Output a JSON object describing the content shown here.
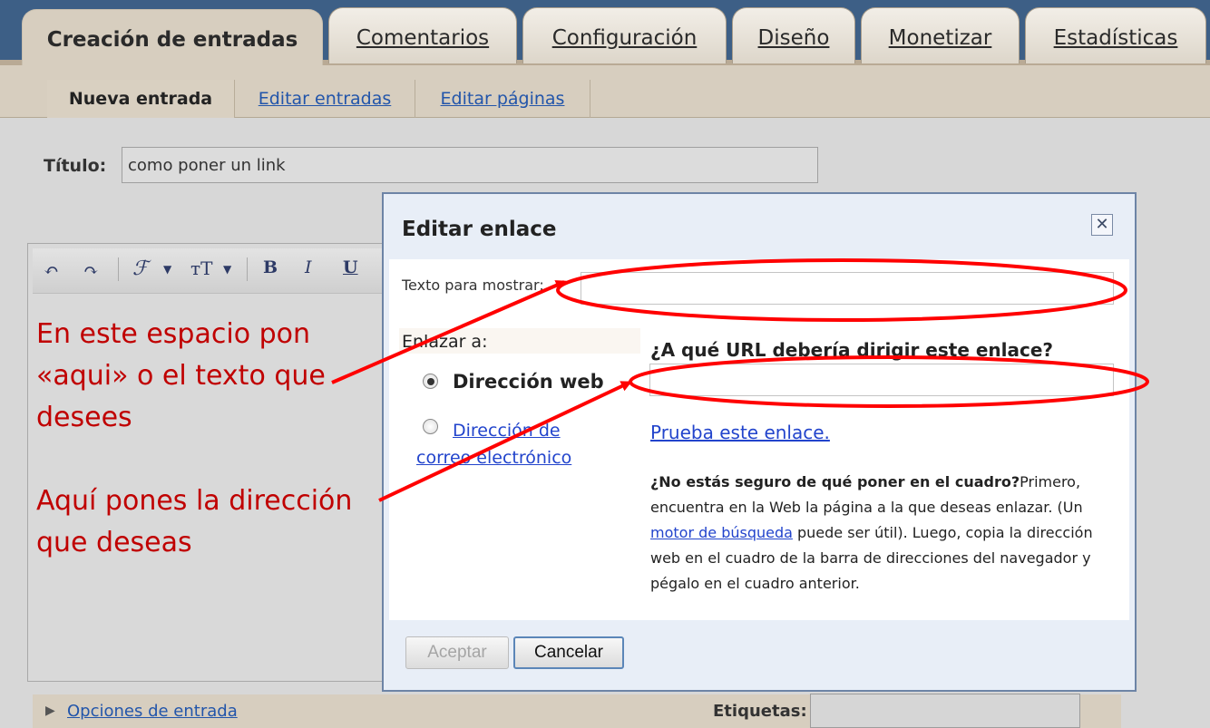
{
  "tabs": [
    {
      "label": "Creación de entradas",
      "active": true
    },
    {
      "label": "Comentarios"
    },
    {
      "label": "Configuración"
    },
    {
      "label": "Diseño"
    },
    {
      "label": "Monetizar"
    },
    {
      "label": "Estadísticas"
    }
  ],
  "subtabs": [
    {
      "label": "Nueva entrada",
      "active": true
    },
    {
      "label": "Editar entradas"
    },
    {
      "label": "Editar páginas"
    }
  ],
  "editor": {
    "title_label": "Título:",
    "title_value": "como poner un link",
    "toolbar": {
      "font": "ℱ",
      "size": "тT",
      "bold": "B",
      "italic": "I",
      "underline": "U"
    }
  },
  "annotations": {
    "text_note": [
      "En este espacio pon",
      "«aqui» o el texto que",
      "desees"
    ],
    "url_note": [
      "Aquí pones la dirección",
      "que deseas"
    ],
    "color": "#c00000"
  },
  "dialog": {
    "title": "Editar enlace",
    "close_label": "✕",
    "text_label": "Texto para mostrar:",
    "text_value": "",
    "link_to_label": "Enlazar a:",
    "option_web": "Dirección web",
    "option_mail": "Dirección de correo electrónico",
    "url_question": "¿A qué URL debería dirigir este enlace?",
    "url_value": "",
    "test_link": "Prueba este enlace.",
    "help": {
      "bold": "¿No estás seguro de qué poner en el cuadro?",
      "part1": "Primero, encuentra en la Web la página a la que deseas enlazar. (Un ",
      "link": "motor de búsqueda",
      "part2": " puede ser útil). Luego, copia la dirección web en el cuadro de la barra de direcciones del navegador y pégalo en el cuadro anterior."
    },
    "accept": "Aceptar",
    "cancel": "Cancelar"
  },
  "footer": {
    "options_link": "Opciones de entrada",
    "labels_label": "Etiquetas:"
  }
}
